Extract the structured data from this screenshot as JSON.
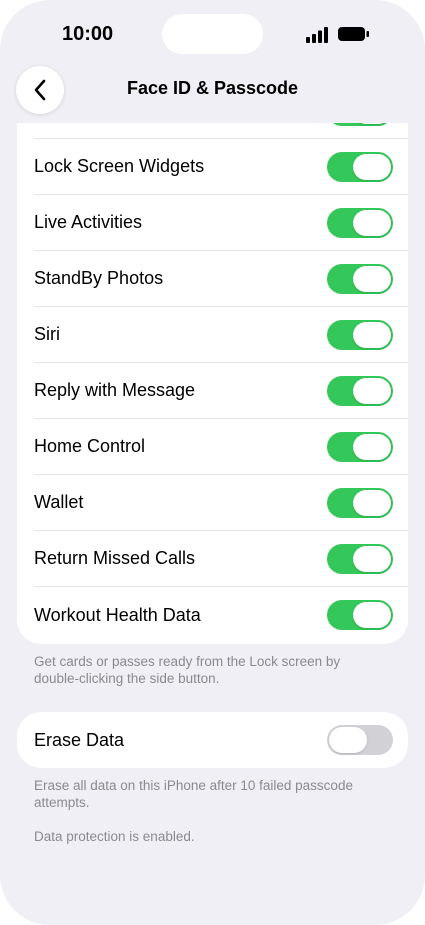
{
  "status_bar": {
    "time": "10:00",
    "icons": [
      "signal-icon",
      "battery-icon"
    ]
  },
  "nav": {
    "back_icon": "chevron-left-icon",
    "title": "Face ID & Passcode"
  },
  "allow_access_list": {
    "items": [
      {
        "label": "Lock Screen Widgets",
        "on": true
      },
      {
        "label": "Live Activities",
        "on": true
      },
      {
        "label": "StandBy Photos",
        "on": true
      },
      {
        "label": "Siri",
        "on": true
      },
      {
        "label": "Reply with Message",
        "on": true
      },
      {
        "label": "Home Control",
        "on": true
      },
      {
        "label": "Wallet",
        "on": true
      },
      {
        "label": "Return Missed Calls",
        "on": true
      },
      {
        "label": "Workout Health Data",
        "on": true
      }
    ],
    "footnote": "Get cards or passes ready from the Lock screen by double-clicking the side button."
  },
  "erase_data": {
    "label": "Erase Data",
    "on": false,
    "footnote": "Erase all data on this iPhone after 10 failed passcode attempts.",
    "protection_note": "Data protection is enabled."
  },
  "colors": {
    "toggle_on": "#34c759",
    "toggle_off": "#d1d1d6",
    "background": "#f0eff5",
    "secondary_text": "#8a8a8e"
  }
}
